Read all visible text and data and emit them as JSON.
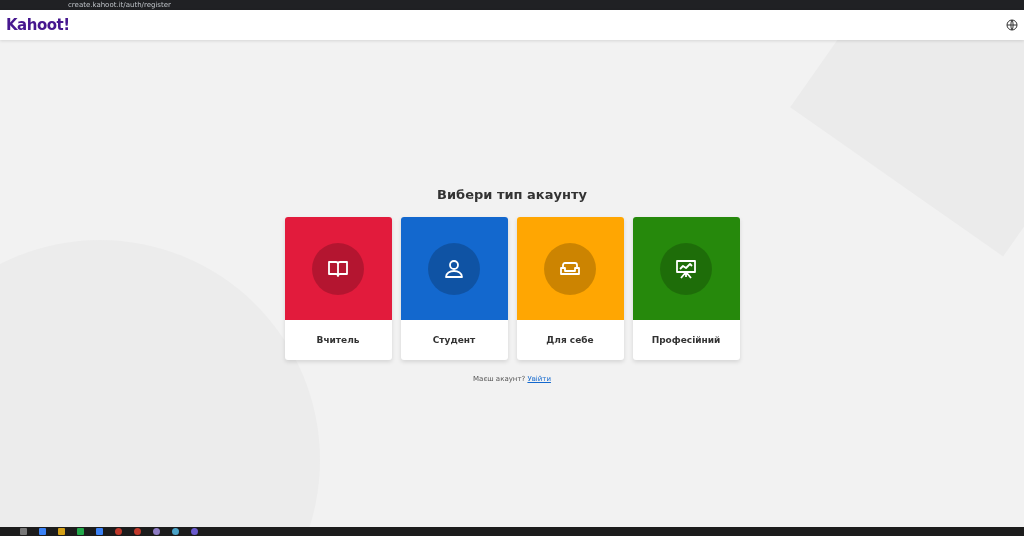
{
  "browser": {
    "url": "create.kahoot.it/auth/register"
  },
  "header": {
    "logo": "Kahoot!"
  },
  "title": "Вибери тип акаунту",
  "account_types": [
    {
      "kind": "book",
      "label": "Вчитель",
      "color": "#e21b3c"
    },
    {
      "kind": "person",
      "label": "Студент",
      "color": "#1368ce"
    },
    {
      "kind": "sofa",
      "label": "Для себе",
      "color": "#ffa602"
    },
    {
      "kind": "presentation",
      "label": "Професійний",
      "color": "#26890c"
    }
  ],
  "login_prompt": {
    "text": "Маєш акаунт?",
    "link": "Увійти"
  }
}
